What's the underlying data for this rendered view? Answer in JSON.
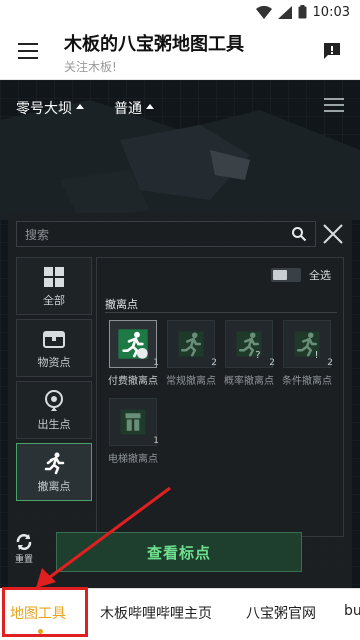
{
  "status": {
    "time": "10:03"
  },
  "app": {
    "title": "木板的八宝粥地图工具",
    "subtitle": "关注木板!"
  },
  "map": {
    "map_select": "零号大坝",
    "mode_select": "普通",
    "search_placeholder": "搜索",
    "select_all": "全选",
    "section_title": "撤离点",
    "categories": [
      {
        "label": "全部",
        "icon": "grid-icon"
      },
      {
        "label": "物资点",
        "icon": "chest-icon"
      },
      {
        "label": "出生点",
        "icon": "location-pin-icon"
      },
      {
        "label": "撤离点",
        "icon": "running-man-icon",
        "active": true
      }
    ],
    "markers": [
      {
        "label": "付费撤离点",
        "count": "1",
        "badge": "+",
        "selected": true
      },
      {
        "label": "常规撤离点",
        "count": "2",
        "badge": ""
      },
      {
        "label": "概率撤离点",
        "count": "2",
        "badge": "?"
      },
      {
        "label": "条件撤离点",
        "count": "2",
        "badge": "!"
      },
      {
        "label": "电梯撤离点",
        "count": "1",
        "badge": ""
      }
    ],
    "refresh_label": "重置",
    "view_button": "查看标点"
  },
  "tabs": [
    {
      "label": "地图工具",
      "active": true
    },
    {
      "label": "木板哔哩哔哩主页"
    },
    {
      "label": "八宝粥官网"
    },
    {
      "label": "bu"
    }
  ],
  "colors": {
    "accent_green": "#6ee08e",
    "active_tab": "#e6a41b",
    "highlight": "#e02020"
  }
}
